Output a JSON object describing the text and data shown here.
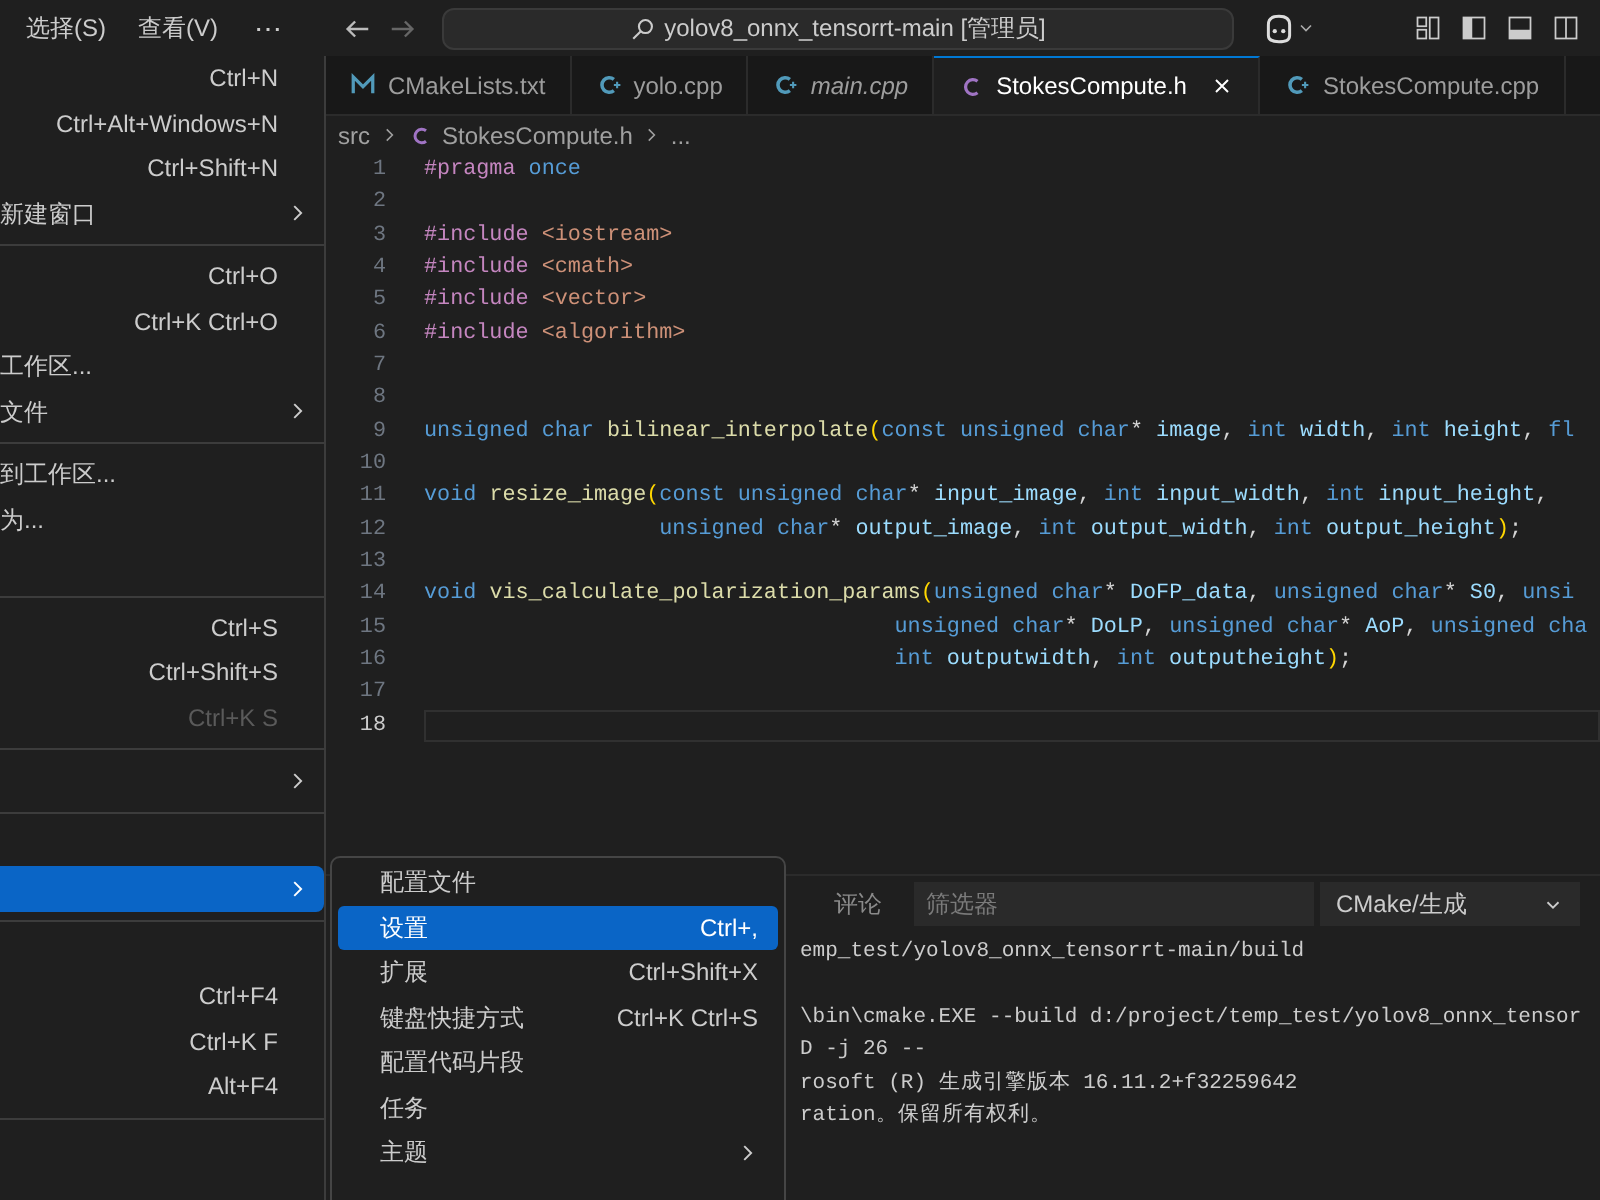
{
  "title_bar": {
    "menus": [
      "选择(S)",
      "查看(V)"
    ],
    "more": "⋯",
    "search": "yolov8_onnx_tensorrt-main [管理员]"
  },
  "file_menu": [
    {
      "kind": "item",
      "shortcut": "Ctrl+N"
    },
    {
      "kind": "item",
      "shortcut": "Ctrl+Alt+Windows+N"
    },
    {
      "kind": "item",
      "shortcut": "Ctrl+Shift+N"
    },
    {
      "kind": "item",
      "label": "新建窗口",
      "submenu": true
    },
    {
      "kind": "separator"
    },
    {
      "kind": "item",
      "shortcut": "Ctrl+O"
    },
    {
      "kind": "item",
      "shortcut": "Ctrl+K Ctrl+O"
    },
    {
      "kind": "item",
      "label": "工作区..."
    },
    {
      "kind": "item",
      "label": "文件",
      "submenu": true
    },
    {
      "kind": "separator"
    },
    {
      "kind": "item",
      "label": "到工作区..."
    },
    {
      "kind": "item",
      "label": "为..."
    },
    {
      "kind": "item"
    },
    {
      "kind": "separator"
    },
    {
      "kind": "item",
      "shortcut": "Ctrl+S"
    },
    {
      "kind": "item",
      "shortcut": "Ctrl+Shift+S"
    },
    {
      "kind": "item",
      "shortcut": "Ctrl+K S",
      "disabled": true
    },
    {
      "kind": "separator"
    },
    {
      "kind": "item",
      "submenu": true
    },
    {
      "kind": "separator"
    },
    {
      "kind": "item"
    },
    {
      "kind": "item",
      "submenu": true,
      "selected": true
    },
    {
      "kind": "separator"
    },
    {
      "kind": "item"
    },
    {
      "kind": "item",
      "shortcut": "Ctrl+F4"
    },
    {
      "kind": "item",
      "shortcut": "Ctrl+K F"
    },
    {
      "kind": "item",
      "shortcut": "Alt+F4"
    },
    {
      "kind": "separator"
    }
  ],
  "submenu": [
    {
      "label": "配置文件",
      "selected": false
    },
    {
      "label": "设置",
      "shortcut": "Ctrl+,",
      "selected": true
    },
    {
      "label": "扩展",
      "shortcut": "Ctrl+Shift+X",
      "selected": false
    },
    {
      "label": "键盘快捷方式",
      "shortcut": "Ctrl+K Ctrl+S",
      "selected": false
    },
    {
      "label": "配置代码片段",
      "selected": false
    },
    {
      "label": "任务",
      "selected": false
    },
    {
      "label": "主题",
      "submenu": true,
      "selected": false
    }
  ],
  "tabs": [
    {
      "label": "CMakeLists.txt",
      "kind": "cmake",
      "selected": false,
      "italic": false
    },
    {
      "label": "yolo.cpp",
      "kind": "cpp",
      "selected": false,
      "italic": false
    },
    {
      "label": "main.cpp",
      "kind": "cpp",
      "selected": false,
      "italic": true
    },
    {
      "label": "StokesCompute.h",
      "kind": "header",
      "selected": true,
      "italic": false
    },
    {
      "label": "StokesCompute.cpp",
      "kind": "cpp",
      "selected": false,
      "italic": false
    }
  ],
  "breadcrumb": [
    "src",
    "StokesCompute.h",
    "..."
  ],
  "code": [
    {
      "number": "1",
      "current": false,
      "tokens": [
        {
          "text": "#pragma",
          "kind": "pre"
        },
        {
          "text": " once",
          "kind": "kw"
        }
      ]
    },
    {
      "number": "2",
      "current": false
    },
    {
      "number": "3",
      "current": false,
      "tokens": [
        {
          "text": "#include",
          "kind": "pre"
        },
        {
          "text": " <iostream>",
          "kind": "str"
        }
      ]
    },
    {
      "number": "4",
      "current": false,
      "tokens": [
        {
          "text": "#include",
          "kind": "pre"
        },
        {
          "text": " <cmath>",
          "kind": "str"
        }
      ]
    },
    {
      "number": "5",
      "current": false,
      "tokens": [
        {
          "text": "#include",
          "kind": "pre"
        },
        {
          "text": " <vector>",
          "kind": "str"
        }
      ]
    },
    {
      "number": "6",
      "current": false,
      "tokens": [
        {
          "text": "#include",
          "kind": "pre"
        },
        {
          "text": " <algorithm>",
          "kind": "str"
        }
      ]
    },
    {
      "number": "7",
      "current": false
    },
    {
      "number": "8",
      "current": false
    },
    {
      "number": "9",
      "current": false,
      "tokens": [
        {
          "text": "unsigned char",
          "kind": "kw"
        },
        {
          "text": " bilinear_interpolate",
          "kind": "fn"
        },
        {
          "text": "(",
          "kind": "paren"
        },
        {
          "text": "const unsigned char",
          "kind": "kw"
        },
        {
          "text": "* ",
          "kind": "op"
        },
        {
          "text": "image",
          "kind": "var"
        },
        {
          "text": ", ",
          "kind": "op"
        },
        {
          "text": "int",
          "kind": "kw"
        },
        {
          "text": " width",
          "kind": "var"
        },
        {
          "text": ", ",
          "kind": "op"
        },
        {
          "text": "int",
          "kind": "kw"
        },
        {
          "text": " height",
          "kind": "var"
        },
        {
          "text": ", ",
          "kind": "op"
        },
        {
          "text": "fl",
          "kind": "kw"
        }
      ]
    },
    {
      "number": "10",
      "current": false
    },
    {
      "number": "11",
      "current": false,
      "tokens": [
        {
          "text": "void",
          "kind": "kw"
        },
        {
          "text": " resize_image",
          "kind": "fn"
        },
        {
          "text": "(",
          "kind": "paren"
        },
        {
          "text": "const unsigned char",
          "kind": "kw"
        },
        {
          "text": "* ",
          "kind": "op"
        },
        {
          "text": "input_image",
          "kind": "var"
        },
        {
          "text": ", ",
          "kind": "op"
        },
        {
          "text": "int",
          "kind": "kw"
        },
        {
          "text": " input_width",
          "kind": "var"
        },
        {
          "text": ", ",
          "kind": "op"
        },
        {
          "text": "int",
          "kind": "kw"
        },
        {
          "text": " input_height",
          "kind": "var"
        },
        {
          "text": ",",
          "kind": "op"
        }
      ]
    },
    {
      "number": "12",
      "current": false,
      "tokens": [
        {
          "text": "                  unsigned char",
          "kind": "kw"
        },
        {
          "text": "* ",
          "kind": "op"
        },
        {
          "text": "output_image",
          "kind": "var"
        },
        {
          "text": ", ",
          "kind": "op"
        },
        {
          "text": "int",
          "kind": "kw"
        },
        {
          "text": " output_width",
          "kind": "var"
        },
        {
          "text": ", ",
          "kind": "op"
        },
        {
          "text": "int",
          "kind": "kw"
        },
        {
          "text": " output_height",
          "kind": "var"
        },
        {
          "text": ")",
          "kind": "paren"
        },
        {
          "text": ";",
          "kind": "op"
        }
      ]
    },
    {
      "number": "13",
      "current": false
    },
    {
      "number": "14",
      "current": false,
      "tokens": [
        {
          "text": "void",
          "kind": "kw"
        },
        {
          "text": " vis_calculate_polarization_params",
          "kind": "fn"
        },
        {
          "text": "(",
          "kind": "paren"
        },
        {
          "text": "unsigned char",
          "kind": "kw"
        },
        {
          "text": "* ",
          "kind": "op"
        },
        {
          "text": "DoFP_data",
          "kind": "var"
        },
        {
          "text": ", ",
          "kind": "op"
        },
        {
          "text": "unsigned char",
          "kind": "kw"
        },
        {
          "text": "* ",
          "kind": "op"
        },
        {
          "text": "S0",
          "kind": "var"
        },
        {
          "text": ", ",
          "kind": "op"
        },
        {
          "text": "unsi",
          "kind": "kw"
        }
      ]
    },
    {
      "number": "15",
      "current": false,
      "tokens": [
        {
          "text": "                                    unsigned char",
          "kind": "kw"
        },
        {
          "text": "* ",
          "kind": "op"
        },
        {
          "text": "DoLP",
          "kind": "var"
        },
        {
          "text": ", ",
          "kind": "op"
        },
        {
          "text": "unsigned char",
          "kind": "kw"
        },
        {
          "text": "* ",
          "kind": "op"
        },
        {
          "text": "AoP",
          "kind": "var"
        },
        {
          "text": ", ",
          "kind": "op"
        },
        {
          "text": "unsigned cha",
          "kind": "kw"
        }
      ]
    },
    {
      "number": "16",
      "current": false,
      "tokens": [
        {
          "text": "                                    int",
          "kind": "kw"
        },
        {
          "text": " outputwidth",
          "kind": "var"
        },
        {
          "text": ", ",
          "kind": "op"
        },
        {
          "text": "int",
          "kind": "kw"
        },
        {
          "text": " outputheight",
          "kind": "var"
        },
        {
          "text": ")",
          "kind": "paren"
        },
        {
          "text": ";",
          "kind": "op"
        }
      ]
    },
    {
      "number": "17",
      "current": false
    },
    {
      "number": "18",
      "current": true
    }
  ],
  "panel": {
    "tab": "评论",
    "filter_placeholder": "筛选器",
    "dropdown": "CMake/生成",
    "output": [
      "emp_test/yolov8_onnx_tensorrt-main/build",
      "\\bin\\cmake.EXE --build d:/project/temp_test/yolov8_onnx_tensor",
      "D -j 26 --",
      "rosoft (R) 生成引擎版本 16.11.2+f32259642",
      "ration。保留所有权利。"
    ]
  }
}
